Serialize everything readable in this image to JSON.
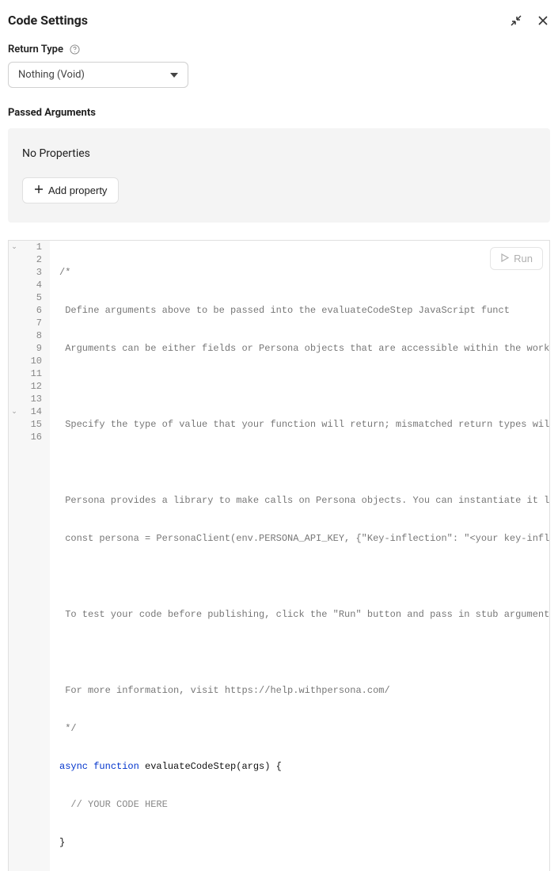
{
  "header": {
    "title": "Code Settings"
  },
  "returnType": {
    "label": "Return Type",
    "value": "Nothing (Void)"
  },
  "passedArgs": {
    "label": "Passed Arguments",
    "emptyText": "No Properties",
    "addButton": "Add property"
  },
  "runButton": "Run",
  "code": {
    "lines": [
      "/*",
      " Define arguments above to be passed into the evaluateCodeStep JavaScript funct",
      " Arguments can be either fields or Persona objects that are accessible within the workfl",
      "",
      " Specify the type of value that your function will return; mismatched return types will ",
      "",
      " Persona provides a library to make calls on Persona objects. You can instantiate it lik",
      " const persona = PersonaClient(env.PERSONA_API_KEY, {\"Key-inflection\": \"<your key-inflect",
      "",
      " To test your code before publishing, click the \"Run\" button and pass in stub arguments.",
      "",
      " For more information, visit https://help.withpersona.com/",
      " */"
    ],
    "asyncKw": "async",
    "funcKw": "function",
    "fnName": "evaluateCodeStep(args)",
    "openBrace": " {",
    "bodyComment": "  // YOUR CODE HERE",
    "closeBrace": "}"
  }
}
